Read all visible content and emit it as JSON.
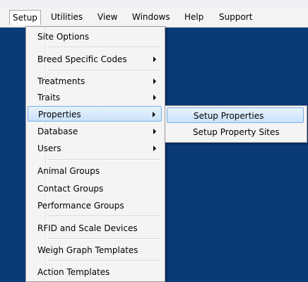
{
  "menubar": {
    "items": [
      {
        "label": "Setup"
      },
      {
        "label": "Utilities"
      },
      {
        "label": "View"
      },
      {
        "label": "Windows"
      },
      {
        "label": "Help"
      },
      {
        "label": "Support"
      }
    ]
  },
  "setup_menu": {
    "items": [
      {
        "label": "Site Options"
      },
      {
        "label": "Breed Specific Codes"
      },
      {
        "label": "Treatments"
      },
      {
        "label": "Traits"
      },
      {
        "label": "Properties"
      },
      {
        "label": "Database"
      },
      {
        "label": "Users"
      },
      {
        "label": "Animal Groups"
      },
      {
        "label": "Contact Groups"
      },
      {
        "label": "Performance Groups"
      },
      {
        "label": "RFID and Scale Devices"
      },
      {
        "label": "Weigh Graph Templates"
      },
      {
        "label": "Action Templates"
      }
    ]
  },
  "properties_submenu": {
    "items": [
      {
        "label": "Setup Properties"
      },
      {
        "label": "Setup Property Sites"
      }
    ]
  },
  "colors": {
    "background": "#0a3a78",
    "highlight": "#cce4f8"
  }
}
